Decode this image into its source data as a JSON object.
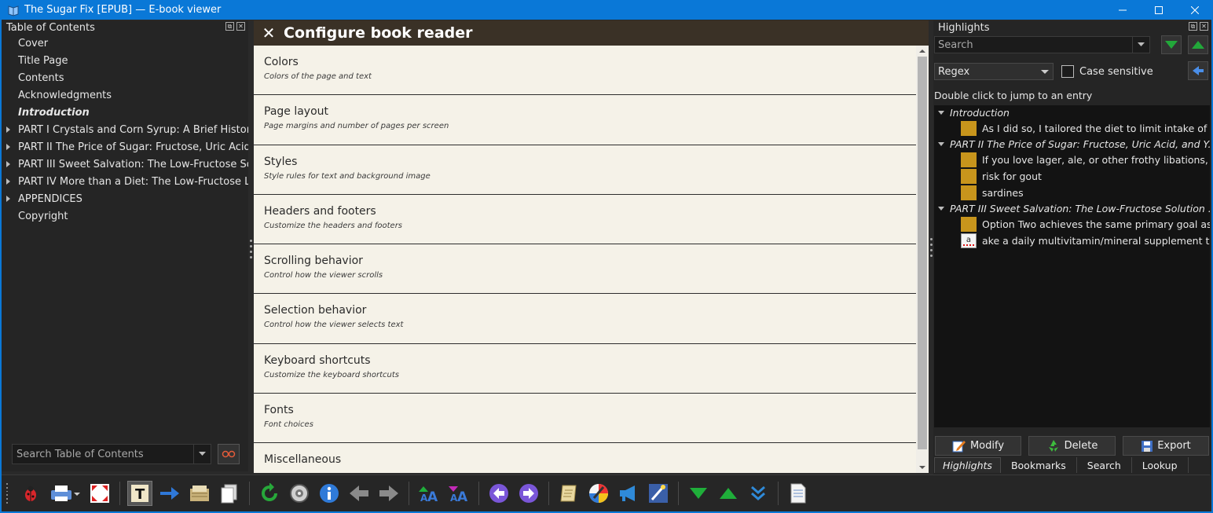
{
  "window": {
    "title": "The Sugar Fix [EPUB] — E-book viewer",
    "controls": [
      "minimize",
      "maximize",
      "close"
    ]
  },
  "toc": {
    "title": "Table of Contents",
    "items": [
      {
        "label": "Cover",
        "expandable": false,
        "current": false
      },
      {
        "label": "Title Page",
        "expandable": false,
        "current": false
      },
      {
        "label": "Contents",
        "expandable": false,
        "current": false
      },
      {
        "label": "Acknowledgments",
        "expandable": false,
        "current": false
      },
      {
        "label": "Introduction",
        "expandable": false,
        "current": true
      },
      {
        "label": "PART I Crystals and Corn Syrup: A Brief History ...",
        "expandable": true,
        "current": false
      },
      {
        "label": "PART II The Price of Sugar: Fructose, Uric Acid,...",
        "expandable": true,
        "current": false
      },
      {
        "label": "PART III Sweet Salvation: The Low-Fructose Sol...",
        "expandable": true,
        "current": false
      },
      {
        "label": "PART IV More than a Diet: The Low-Fructose Lif...",
        "expandable": true,
        "current": false
      },
      {
        "label": "APPENDICES",
        "expandable": true,
        "current": false
      },
      {
        "label": "Copyright",
        "expandable": false,
        "current": false
      }
    ],
    "search_placeholder": "Search Table of Contents"
  },
  "config": {
    "title": "Configure book reader",
    "items": [
      {
        "heading": "Colors",
        "sub": "Colors of the page and text"
      },
      {
        "heading": "Page layout",
        "sub": "Page margins and number of pages per screen"
      },
      {
        "heading": "Styles",
        "sub": "Style rules for text and background image"
      },
      {
        "heading": "Headers and footers",
        "sub": "Customize the headers and footers"
      },
      {
        "heading": "Scrolling behavior",
        "sub": "Control how the viewer scrolls"
      },
      {
        "heading": "Selection behavior",
        "sub": "Control how the viewer selects text"
      },
      {
        "heading": "Keyboard shortcuts",
        "sub": "Customize the keyboard shortcuts"
      },
      {
        "heading": "Fonts",
        "sub": "Font choices"
      },
      {
        "heading": "Miscellaneous",
        "sub": ""
      }
    ]
  },
  "highlights": {
    "title": "Highlights",
    "search_placeholder": "Search",
    "mode": "Regex",
    "case_sensitive_label": "Case sensitive",
    "case_sensitive_checked": false,
    "hint": "Double click to jump to an entry",
    "sections": [
      {
        "title": "Introduction",
        "entries": [
          {
            "text": "As I did so, I tailored the diet to limit intake of o...",
            "style": "yellow"
          }
        ]
      },
      {
        "title": "PART II The Price of Sugar: Fructose, Uric Acid, and Y...",
        "entries": [
          {
            "text": "If you love lager, ale, or other frothy libations, t...",
            "style": "yellow"
          },
          {
            "text": "risk for gout",
            "style": "yellow"
          },
          {
            "text": "sardines",
            "style": "yellow"
          }
        ]
      },
      {
        "title": "PART III Sweet Salvation: The Low-Fructose Solution ...",
        "entries": [
          {
            "text": "Option Two achieves the same primary goal as ...",
            "style": "yellow"
          },
          {
            "text": "ake a daily multivitamin/mineral supplement to ...",
            "style": "squiggly",
            "glyph": "a"
          }
        ]
      }
    ],
    "buttons": {
      "modify": "Modify",
      "delete": "Delete",
      "export": "Export"
    },
    "tabs": [
      {
        "label": "Highlights",
        "active": true
      },
      {
        "label": "Bookmarks",
        "active": false
      },
      {
        "label": "Search",
        "active": false
      },
      {
        "label": "Lookup",
        "active": false
      }
    ]
  },
  "toolbar": {
    "icons": [
      "bug-icon",
      "print-icon",
      "fullscreen-icon",
      "text-mode-icon",
      "pointer-icon",
      "toc-icon",
      "copy-icon",
      "reload-icon",
      "preferences-icon",
      "info-icon",
      "back-icon",
      "forward-icon",
      "font-larger-icon",
      "font-smaller-icon",
      "previous-icon",
      "next-icon",
      "scroll-icon",
      "color-scheme-icon",
      "read-aloud-icon",
      "lookup-icon",
      "next-section-icon",
      "previous-section-icon",
      "next-page-icon",
      "metadata-icon"
    ]
  },
  "colors": {
    "titlebar": "#0a78d7",
    "highlight_yellow": "#c8951c",
    "config_bg": "#f5f2e8",
    "config_header_bg": "#3a3126"
  }
}
